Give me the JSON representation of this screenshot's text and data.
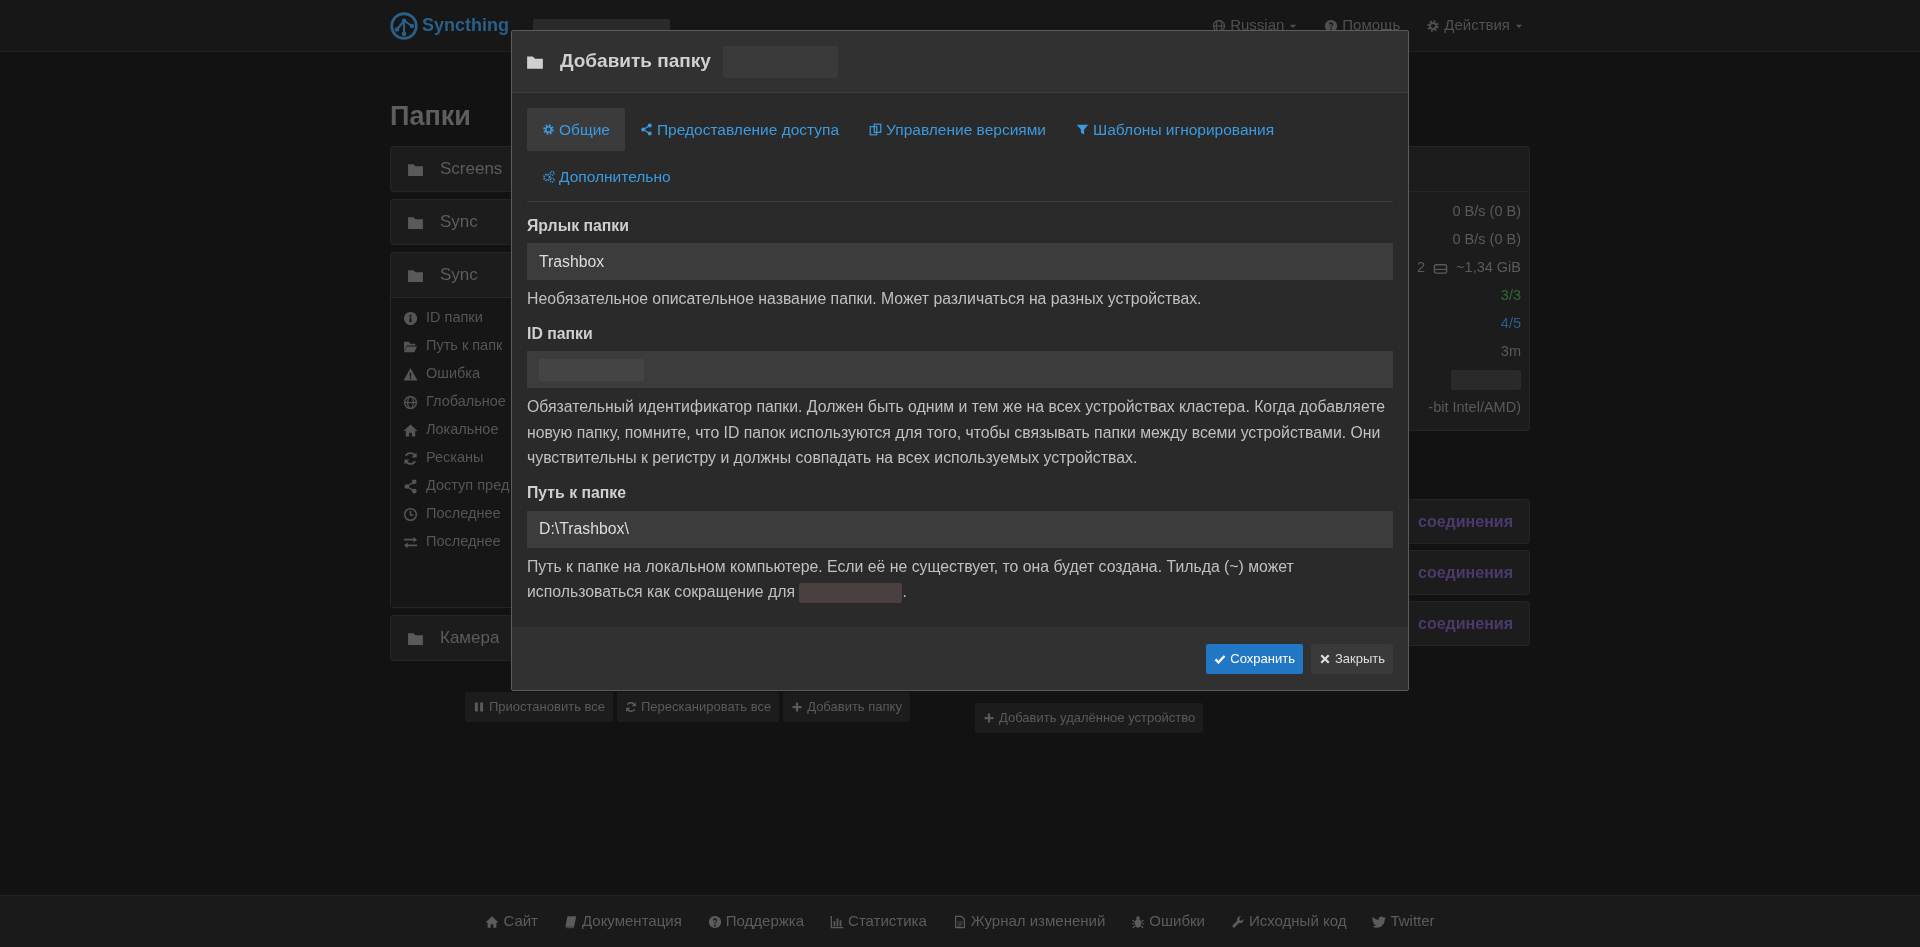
{
  "navbar": {
    "brand": "Syncthing",
    "device_redacted": true,
    "menus": [
      {
        "label": "Russian",
        "caret": true
      },
      {
        "label": "Помощь",
        "caret": false
      },
      {
        "label": "Действия",
        "caret": true
      }
    ]
  },
  "page_title": "Папки",
  "folders": [
    {
      "name": "Screens",
      "expanded": false
    },
    {
      "name": "Sync",
      "expanded": false
    },
    {
      "name": "Sync",
      "expanded": true,
      "details": [
        "ID папки",
        "Путь к папк",
        "Ошибка",
        "Глобальное",
        "Локальное",
        "Ресканы",
        "Доступ пред",
        "Последнее",
        "Последнее"
      ]
    },
    {
      "name": "Камера",
      "expanded": false
    }
  ],
  "folder_buttons": [
    "Приостановить все",
    "Пересканировать все",
    "Добавить папку"
  ],
  "this_device": {
    "rows": [
      {
        "text": "0 B/s (0 B)",
        "color": "#5a5a5a"
      },
      {
        "text": "0 B/s (0 B)",
        "color": "#5a5a5a"
      },
      {
        "lead": "2",
        "text": "~1,34 GiB",
        "color": "#5a5a5a"
      },
      {
        "text": "3/3",
        "color": "#2f6b2f"
      },
      {
        "text": "4/5",
        "color": "#2c5c8c"
      },
      {
        "text": "3m",
        "color": "#5a5a5a"
      },
      {
        "redacted": true
      },
      {
        "text": "-bit Intel/AMD)",
        "color": "#5a5a5a"
      }
    ]
  },
  "devices": [
    {
      "status": "соединения"
    },
    {
      "status": "соединения"
    },
    {
      "status": "соединения"
    }
  ],
  "device_button": "Добавить удалённое устройство",
  "footer": [
    "Сайт",
    "Документация",
    "Поддержка",
    "Статистика",
    "Журнал изменений",
    "Ошибки",
    "Исходный код",
    "Twitter"
  ],
  "modal": {
    "title": "Добавить папку",
    "title_redacted": true,
    "tabs": [
      {
        "label": "Общие",
        "selected": true
      },
      {
        "label": "Предоставление доступа",
        "selected": false
      },
      {
        "label": "Управление версиями",
        "selected": false
      },
      {
        "label": "Шаблоны игнорирования",
        "selected": false
      },
      {
        "label": "Дополнительно",
        "selected": false
      }
    ],
    "fields": [
      {
        "label": "Ярлык папки",
        "value": "Trashbox",
        "help": "Необязательное описательное название папки. Может различаться на разных устройствах."
      },
      {
        "label": "ID папки",
        "redacted": true,
        "help": "Обязательный идентификатор папки. Должен быть одним и тем же на всех устройствах кластера. Когда добавляете новую папку, помните, что ID папок используются для того, чтобы связывать папки между всеми устройствами. Они чувствительны к регистру и должны совпадать на всех используемых устройствах."
      },
      {
        "label": "Путь к папке",
        "value": "D:\\Trashbox\\",
        "help": "Путь к папке на локальном компьютере. Если её не существует, то она будет создана. Тильда (~) может использоваться как сокращение для",
        "help_redacted": true,
        "help_end": "."
      }
    ],
    "buttons": [
      {
        "label": "Сохранить",
        "kind": "primary"
      },
      {
        "label": "Закрыть",
        "kind": "secondary"
      }
    ]
  }
}
